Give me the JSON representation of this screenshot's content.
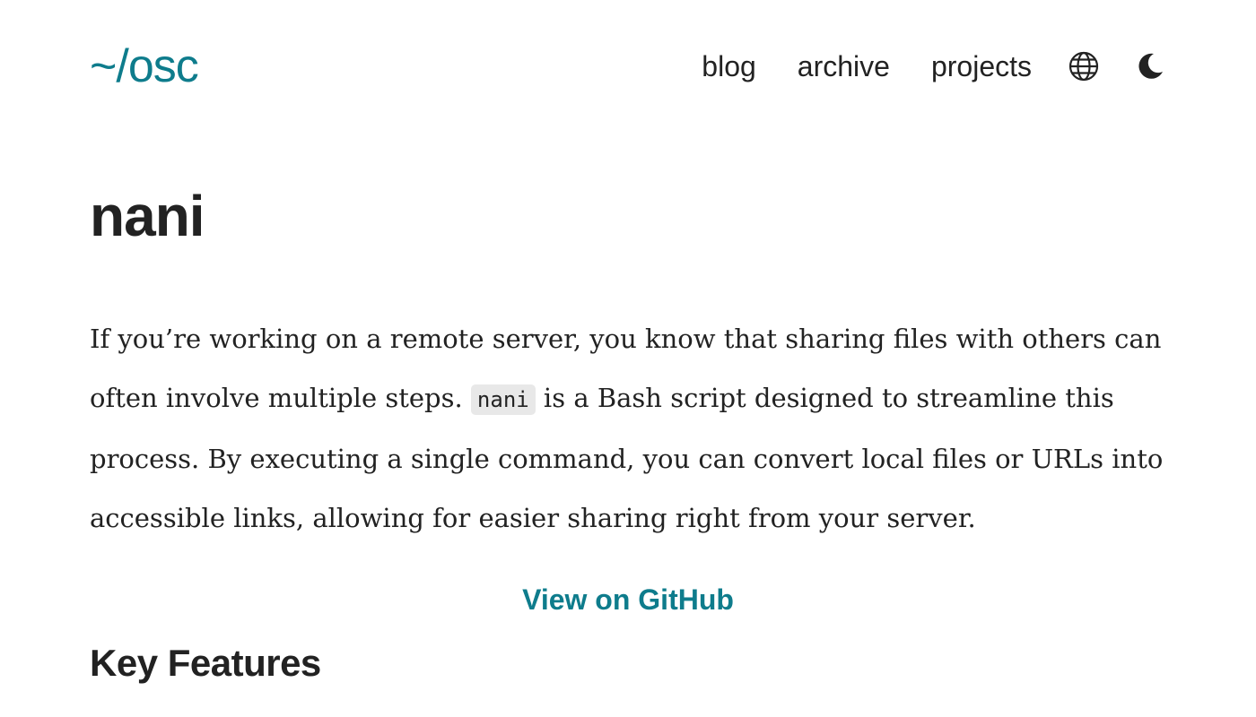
{
  "header": {
    "logo": "~/osc",
    "nav": [
      {
        "label": "blog"
      },
      {
        "label": "archive"
      },
      {
        "label": "projects"
      }
    ],
    "icons": {
      "language": "globe-icon",
      "theme": "moon-icon"
    }
  },
  "main": {
    "title": "nani",
    "intro": {
      "part1": "If you’re working on a remote server, you know that sharing files with others can often involve multiple steps. ",
      "code": "nani",
      "part2": " is a Bash script designed to streamline this process. By executing a single command, you can convert local files or URLs into accessible links, allowing for easier sharing right from your server."
    },
    "github_link": "View on GitHub",
    "section_heading": "Key Features"
  },
  "colors": {
    "accent": "#0e7c8c",
    "text": "#222222",
    "code_bg": "#e8e8e8",
    "background": "#ffffff"
  }
}
